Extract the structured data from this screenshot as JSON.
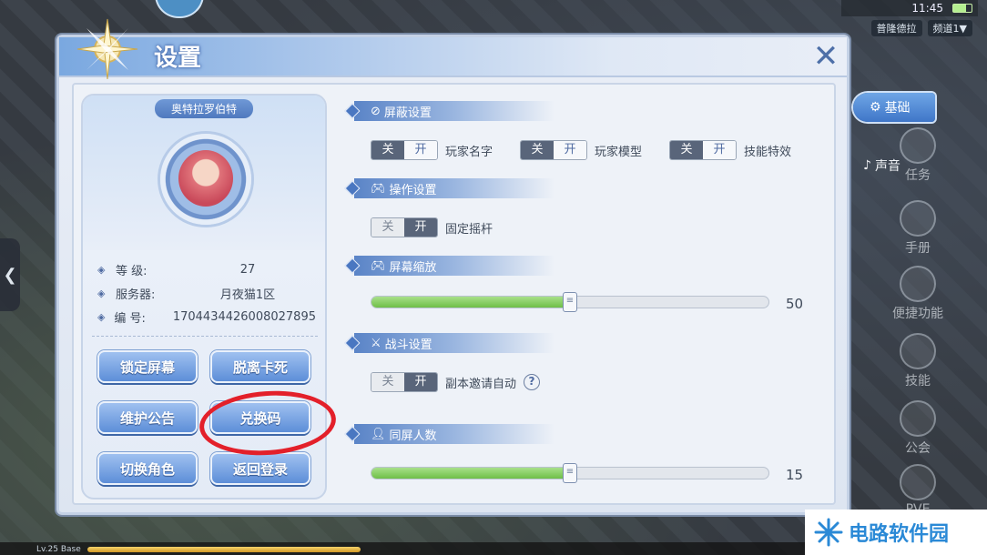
{
  "status": {
    "time": "11:45"
  },
  "channel": {
    "tab_a": "普隆德拉",
    "tab_b": "频道1▼"
  },
  "exp_bar": {
    "label": "Lv.25 Base"
  },
  "right_menu": [
    {
      "label": "任务"
    },
    {
      "label": "手册"
    },
    {
      "label": "便捷功能"
    },
    {
      "label": "技能"
    },
    {
      "label": "公会"
    },
    {
      "label": "PVE"
    }
  ],
  "tabs": {
    "basic": "基础",
    "sound": "声音"
  },
  "panel": {
    "title": "设置",
    "close_symbol": "✕"
  },
  "profile": {
    "name": "奥特拉罗伯特",
    "rows": [
      {
        "label": "等 级:",
        "value": "27"
      },
      {
        "label": "服务器:",
        "value": "月夜猫1区"
      },
      {
        "label": "编 号:",
        "value": "1704434426008027895"
      }
    ],
    "buttons": {
      "lock_screen": "锁定屏幕",
      "unstuck": "脱离卡死",
      "maintenance": "维护公告",
      "redeem_code": "兑换码",
      "switch_role": "切换角色",
      "back_login": "返回登录"
    }
  },
  "sections": {
    "shield": {
      "title": "屏蔽设置",
      "items": [
        {
          "label": "玩家名字",
          "off": "关",
          "on": "开"
        },
        {
          "label": "玩家模型",
          "off": "关",
          "on": "开"
        },
        {
          "label": "技能特效",
          "off": "关",
          "on": "开"
        }
      ]
    },
    "control": {
      "title": "操作设置",
      "items": [
        {
          "label": "固定摇杆",
          "off": "关",
          "on": "开"
        }
      ]
    },
    "zoom": {
      "title": "屏幕缩放",
      "value": 50,
      "value_text": "50",
      "max": 100
    },
    "battle": {
      "title": "战斗设置",
      "items": [
        {
          "label": "副本邀请自动",
          "off": "关",
          "on": "开",
          "help": "?"
        }
      ]
    },
    "same_screen": {
      "title": "同屏人数",
      "value": 50,
      "value_text": "15",
      "max": 100
    }
  },
  "watermark": {
    "text": "电路软件园"
  }
}
